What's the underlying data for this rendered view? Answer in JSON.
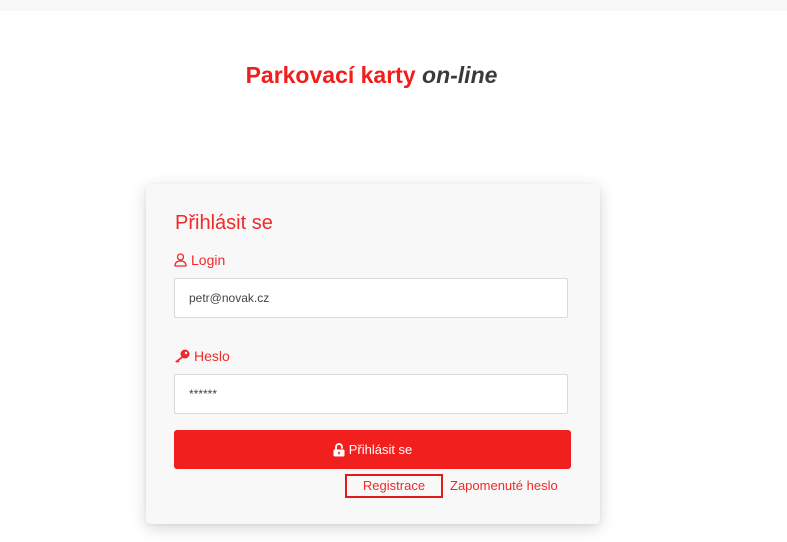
{
  "header": {
    "title_main": "Parkovací karty",
    "title_accent": "on-line"
  },
  "login_form": {
    "title": "Přihlásit se",
    "login_label": "Login",
    "login_value": "petr@novak.cz",
    "password_label": "Heslo",
    "password_value": "******",
    "submit_label": "Přihlásit se",
    "register_link": "Registrace",
    "forgot_link": "Zapomenuté heslo"
  },
  "icons": {
    "login": "user-icon",
    "password": "key-icon",
    "submit": "unlock-icon"
  },
  "colors": {
    "accent": "#f11e1e",
    "title_dark": "#3a3a3a",
    "card_background": "#f8f8f8"
  }
}
